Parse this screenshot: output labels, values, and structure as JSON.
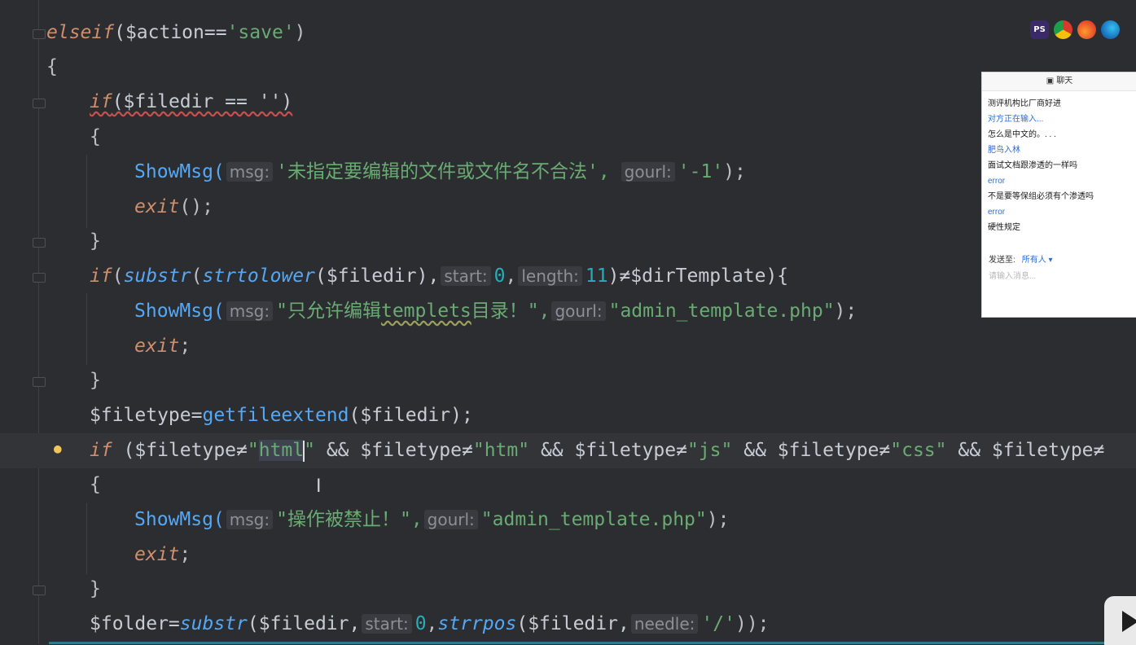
{
  "code": {
    "l1_kw": "elseif",
    "l1_rest": "($action==",
    "l1_str": "'save'",
    "l1_end": ")",
    "l2": "{",
    "l3_kw": "if",
    "l3_rest": "($filedir == '')",
    "l4": "{",
    "l5_fn": "ShowMsg(",
    "l5_hint1": "msg:",
    "l5_str1": "'未指定要编辑的文件或文件名不合法',",
    "l5_hint2": "gourl:",
    "l5_str2": "'-1'",
    "l5_end": ");",
    "l6_fn": "exit",
    "l6_end": "();",
    "l7": "}",
    "l8_kw": "if",
    "l8_a": "(",
    "l8_fn1": "substr",
    "l8_b": "(",
    "l8_fn2": "strtolower",
    "l8_c": "($filedir),",
    "l8_hint1": "start:",
    "l8_num1": "0",
    "l8_d": ",",
    "l8_hint2": "length:",
    "l8_num2": "11",
    "l8_e": ")≠$dirTemplate){",
    "l9_fn": "ShowMsg(",
    "l9_hint1": "msg:",
    "l9_str1a": "\"只允许编辑",
    "l9_str1b": "templets",
    "l9_str1c": "目录！\",",
    "l9_hint2": "gourl:",
    "l9_str2": "\"admin_template.php\"",
    "l9_end": ");",
    "l10_fn": "exit",
    "l10_end": ";",
    "l11": "}",
    "l12_a": "$filetype=",
    "l12_fn": "getfileextend",
    "l12_b": "($filedir);",
    "l13_kw": "if",
    "l13_a": " ($filetype≠",
    "l13_s1a": "\"",
    "l13_s1b": "html",
    "l13_s1c": "\"",
    "l13_b": " && $filetype≠",
    "l13_s2": "\"htm\"",
    "l13_c": " && $filetype≠",
    "l13_s3": "\"js\"",
    "l13_d": " && $filetype≠",
    "l13_s4": "\"css\"",
    "l13_e": " && $filetype≠",
    "l14": "{",
    "l15_fn": "ShowMsg(",
    "l15_hint1": "msg:",
    "l15_str1": "\"操作被禁止！\",",
    "l15_hint2": "gourl:",
    "l15_str2": "\"admin_template.php\"",
    "l15_end": ");",
    "l16_fn": "exit",
    "l16_end": ";",
    "l17": "}",
    "l18_a": "$folder=",
    "l18_fn1": "substr",
    "l18_b": "($filedir,",
    "l18_hint1": "start:",
    "l18_num1": "0",
    "l18_c": ",",
    "l18_fn2": "strrpos",
    "l18_d": "($filedir,",
    "l18_hint2": "needle:",
    "l18_str": "'/'",
    "l18_end": "));"
  },
  "browser_icons": [
    "phpstorm-icon",
    "chrome-icon",
    "firefox-icon",
    "edge-icon"
  ],
  "chat": {
    "title": "聊天",
    "messages": [
      {
        "text": "测评机构比厂商好进",
        "kind": "body"
      },
      {
        "text": "对方正在输入...",
        "kind": "link"
      },
      {
        "text": "怎么是中文的。. . .",
        "kind": "body"
      },
      {
        "text": "肥鸟入林",
        "kind": "link"
      },
      {
        "text": "面试文档跟渗透的一样吗",
        "kind": "body"
      },
      {
        "text": "error",
        "kind": "link"
      },
      {
        "text": "不是要等保组必须有个渗透吗",
        "kind": "body"
      },
      {
        "text": "error",
        "kind": "link"
      },
      {
        "text": "硬性规定",
        "kind": "body"
      }
    ],
    "send_to_label": "发送至:",
    "send_to_value": "所有人",
    "input_placeholder": "请输入消息..."
  },
  "colors": {
    "background": "#2b2d30",
    "keyword": "#cf8e6d",
    "function": "#56a8f5",
    "string": "#6aab73",
    "number": "#2aacb8"
  }
}
